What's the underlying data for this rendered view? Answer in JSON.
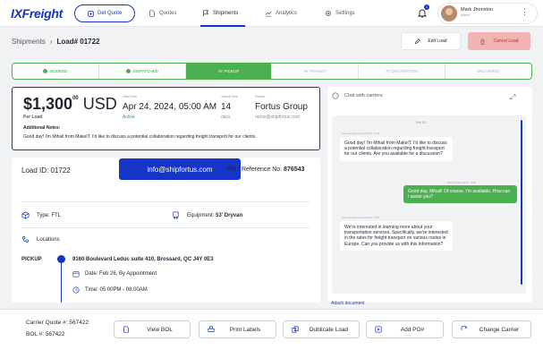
{
  "app": {
    "logo": "IXFreight"
  },
  "nav": {
    "get_quote": "Get Quote",
    "quotes": "Quotes",
    "shipments": "Shipments",
    "analytics": "Analytics",
    "settings": "Settings",
    "notification_count": "1",
    "user_name": "Mark Jhonston",
    "user_role": "Admin"
  },
  "breadcrumb": {
    "root": "Shipments",
    "current": "Load# 01722"
  },
  "actions": {
    "edit": "Edit Load",
    "cancel": "Cancel Load"
  },
  "stepper": {
    "steps": [
      "BOOKED",
      "DISPATCHED",
      "AT PICKUP",
      "IN TRANSIT",
      "AT DESTINATION",
      "DELIVERED"
    ],
    "current": "AT PICKUP"
  },
  "summary": {
    "price_main": "$1,300",
    "price_cents": "00",
    "currency": "USD",
    "per_load": "Per Load",
    "valid_label": "Valid Until",
    "valid_date": "Apr 24, 2024, 05:00 AM",
    "valid_status": "Active",
    "transit_label": "Transit Time",
    "transit_value": "14",
    "transit_unit": "days",
    "partner_label": "Partner",
    "partner_name": "Fortus Group",
    "partner_email": "ramio@shipfortus.com",
    "notes_title": "Additional Notes:",
    "notes_text": "Good day! I'm Mihail from MakeIT. I'd like to discuss a potential collaboration regarding freight transport for our clients."
  },
  "load": {
    "id_label": "Load ID:",
    "id_value": "01722",
    "email_chip": "info@shipfortus.com",
    "po_label": "PO / Reference No.",
    "po_value": "876543",
    "type_label": "Type:",
    "type_value": "FTL",
    "equipment_label": "Equipment:",
    "equipment_value": "53' Dryvan",
    "locations_label": "Locations",
    "pickup_label": "PICKUP",
    "pickup_address": "9160 Boulevard Leduc suite 410, Brossard, QC J4Y 0E3",
    "pickup_date": "Date: Feb 26, By Appointment",
    "pickup_time": "Time: 05:00PM - 08:00AM"
  },
  "chat": {
    "title": "Chat with carriers",
    "date_divider": "Feb 02",
    "messages": [
      {
        "direction": "in",
        "meta": "Jason Mcorvies (Fortus) 09:00 · 10:28",
        "text": "Good day! I'm Mihail from MakeIT. I'd like to discuss a potential collaboration regarding freight transport for our clients. Are you available for a discussion?"
      },
      {
        "direction": "out",
        "meta": "Mark Jhonston 09:00 · 10:48",
        "text": "Good day, Mihail! Of course, I'm available. How can I assist you?"
      },
      {
        "direction": "in",
        "meta": "Jason Mcorvies (Fortus) 09:00 · 10:57",
        "text": "We're interested in learning more about your transportation services. Specifically, we're interested in the rates for freight transport on various routes in Europe. Can you provide us with this information?"
      }
    ],
    "attach_link": "Attach document"
  },
  "bottom": {
    "carrier_quote_label": "Carrier Quote #:",
    "carrier_quote_value": "567422",
    "bol_label": "BOL #:",
    "bol_value": "567422",
    "buttons": [
      "View BOL",
      "Print Labels",
      "Dublicate Load",
      "Add PO#",
      "Change Carrier"
    ]
  },
  "colors": {
    "accent": "#1534c8",
    "success": "#4caf50",
    "danger_bg": "#f2b3b3",
    "background": "#f1f2f4"
  },
  "icons": [
    "quote-icon",
    "document-icon",
    "flag-icon",
    "chart-icon",
    "gear-icon",
    "bell-icon",
    "kebab-icon",
    "pencil-icon",
    "trash-icon",
    "chat-icon",
    "expand-icon",
    "box-icon",
    "truck-icon",
    "map-icon",
    "calendar-icon",
    "clock-icon",
    "file-icon",
    "printer-icon",
    "copy-icon",
    "plus-icon",
    "refresh-icon"
  ]
}
